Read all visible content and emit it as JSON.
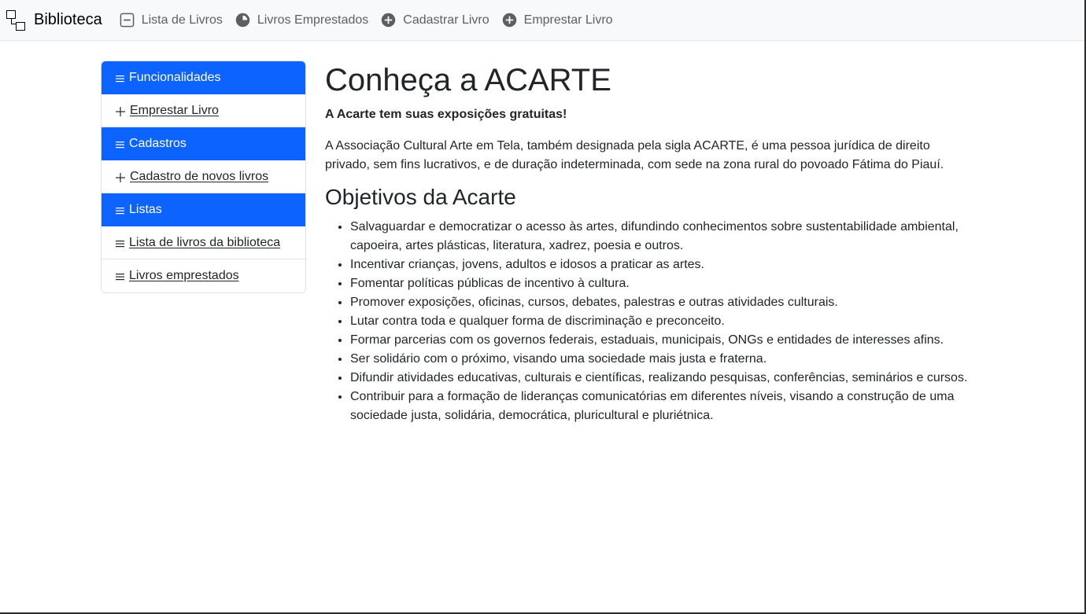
{
  "navbar": {
    "brand": "Biblioteca",
    "items": [
      {
        "label": "Lista de Livros",
        "icon": "dash-square-icon"
      },
      {
        "label": "Livros Emprestados",
        "icon": "pie-chart-icon"
      },
      {
        "label": "Cadastrar Livro",
        "icon": "plus-circle-icon"
      },
      {
        "label": "Emprestar Livro",
        "icon": "plus-circle-icon"
      }
    ]
  },
  "sidebar": {
    "sections": [
      {
        "header": "Funcionalidades",
        "links": [
          {
            "label": " Emprestar Livro",
            "icon": "plus-icon"
          }
        ]
      },
      {
        "header": "Cadastros",
        "links": [
          {
            "label": " Cadastro de novos livros",
            "icon": "plus-icon"
          }
        ]
      },
      {
        "header": "Listas",
        "links": [
          {
            "label": " Lista de livros da biblioteca",
            "icon": "list-icon"
          },
          {
            "label": " Livros emprestados",
            "icon": "list-icon"
          }
        ]
      }
    ]
  },
  "main": {
    "title": "Conheça a ACARTE",
    "lead": "A Acarte tem suas exposições gratuitas!",
    "intro": "A Associação Cultural Arte em Tela, também designada pela sigla ACARTE, é uma pessoa jurídica de direito privado, sem fins lucrativos, e de duração indeterminada, com sede na zona rural do povoado Fátima do Piauí.",
    "objectives_title": "Objetivos da Acarte",
    "objectives": [
      "Salvaguardar e democratizar o acesso às artes, difundindo conhecimentos sobre sustentabilidade ambiental, capoeira, artes plásticas, literatura, xadrez, poesia e outros.",
      "Incentivar crianças, jovens, adultos e idosos a praticar as artes.",
      "Fomentar políticas públicas de incentivo à cultura.",
      "Promover exposições, oficinas, cursos, debates, palestras e outras atividades culturais.",
      "Lutar contra toda e qualquer forma de discriminação e preconceito.",
      "Formar parcerias com os governos federais, estaduais, municipais, ONGs e entidades de interesses afins.",
      "Ser solidário com o próximo, visando uma sociedade mais justa e fraterna.",
      "Difundir atividades educativas, culturais e científicas, realizando pesquisas, conferências, seminários e cursos.",
      "Contribuir para a formação de lideranças comunicatórias em diferentes níveis, visando a construção de uma sociedade justa, solidária, democrática, pluricultural e pluriétnica."
    ]
  },
  "colors": {
    "primary": "#0d63fd",
    "navbar_bg": "#f8f9fa",
    "text": "#212529",
    "nav_text": "#5c5f62"
  }
}
